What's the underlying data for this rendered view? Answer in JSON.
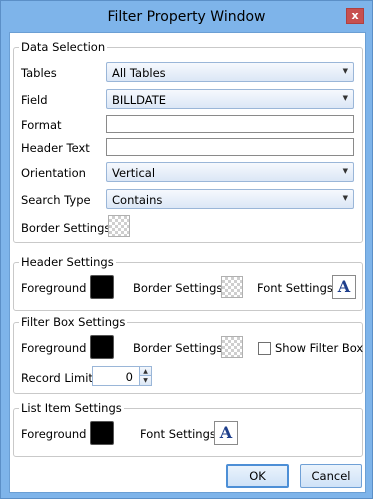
{
  "window": {
    "title": "Filter Property Window",
    "close_glyph": "x"
  },
  "data_selection": {
    "title": "Data Selection",
    "tables_label": "Tables",
    "tables_value": "All Tables",
    "field_label": "Field",
    "field_value": "BILLDATE",
    "format_label": "Format",
    "format_value": "",
    "header_text_label": "Header Text",
    "header_text_value": "",
    "orientation_label": "Orientation",
    "orientation_value": "Vertical",
    "search_type_label": "Search Type",
    "search_type_value": "Contains",
    "border_settings_label": "Border Settings"
  },
  "header_settings": {
    "title": "Header Settings",
    "foreground_label": "Foreground",
    "border_settings_label": "Border Settings",
    "font_settings_label": "Font Settings",
    "font_glyph": "A",
    "foreground_color": "#000000"
  },
  "filter_box_settings": {
    "title": "Filter Box Settings",
    "foreground_label": "Foreground",
    "border_settings_label": "Border Settings",
    "show_filter_box_label": "Show Filter Box",
    "show_filter_box_checked": false,
    "record_limit_label": "Record Limit",
    "record_limit_value": "0",
    "foreground_color": "#000000"
  },
  "list_item_settings": {
    "title": "List Item Settings",
    "foreground_label": "Foreground",
    "font_settings_label": "Font Settings",
    "font_glyph": "A",
    "foreground_color": "#000000"
  },
  "buttons": {
    "ok_label": "OK",
    "cancel_label": "Cancel"
  },
  "icons": {
    "dropdown_arrow": "chevron-down-icon",
    "font": "font-icon",
    "checker": "transparent-pattern-icon"
  },
  "colors": {
    "frame": "#7eb4ea",
    "close": "#c75050",
    "font_icon": "#1f3f8c"
  }
}
